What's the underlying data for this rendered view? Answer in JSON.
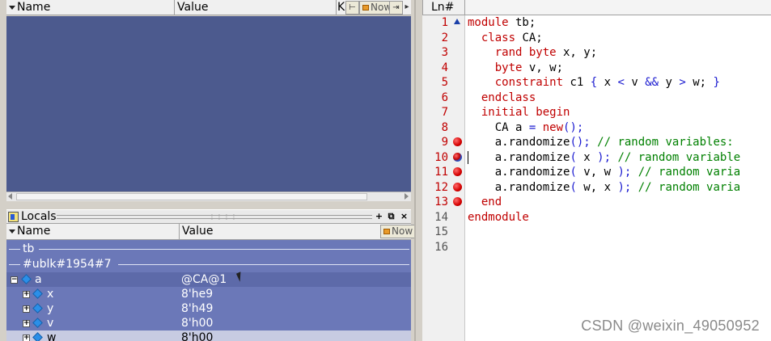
{
  "wave_panel": {
    "columns": [
      {
        "label": "Name"
      },
      {
        "label": "Value"
      },
      {
        "label": "K"
      }
    ],
    "now_label": "Now"
  },
  "locals_panel": {
    "title": "Locals",
    "columns": [
      {
        "label": "Name"
      },
      {
        "label": "Value"
      }
    ],
    "now_label": "Now",
    "groups": [
      "tb",
      "#ublk#1954#7"
    ],
    "rows": [
      {
        "name": "a",
        "value": "@CA@1",
        "expanded": true
      },
      {
        "name": "x",
        "value": "8'he9"
      },
      {
        "name": "y",
        "value": "8'h49"
      },
      {
        "name": "v",
        "value": "8'h00"
      },
      {
        "name": "w",
        "value": "8'h00"
      }
    ]
  },
  "source_panel": {
    "header_label": "Ln#",
    "lines": [
      {
        "num": "1",
        "marker": "arrow",
        "tokens": [
          {
            "t": "module",
            "c": "k"
          },
          {
            "t": " tb;",
            "c": "n"
          }
        ]
      },
      {
        "num": "2",
        "marker": "",
        "tokens": [
          {
            "t": "  class",
            "c": "k"
          },
          {
            "t": " CA;",
            "c": "n"
          }
        ]
      },
      {
        "num": "3",
        "marker": "",
        "tokens": [
          {
            "t": "    rand byte",
            "c": "k"
          },
          {
            "t": " x, y;",
            "c": "n"
          }
        ]
      },
      {
        "num": "4",
        "marker": "",
        "tokens": [
          {
            "t": "    byte",
            "c": "k"
          },
          {
            "t": " v, w;",
            "c": "n"
          }
        ]
      },
      {
        "num": "5",
        "marker": "",
        "tokens": [
          {
            "t": "    constraint",
            "c": "k"
          },
          {
            "t": " c1 ",
            "c": "n"
          },
          {
            "t": "{",
            "c": "b"
          },
          {
            "t": " x ",
            "c": "n"
          },
          {
            "t": "<",
            "c": "b"
          },
          {
            "t": " v ",
            "c": "n"
          },
          {
            "t": "&&",
            "c": "b"
          },
          {
            "t": " y ",
            "c": "n"
          },
          {
            "t": ">",
            "c": "b"
          },
          {
            "t": " w; ",
            "c": "n"
          },
          {
            "t": "}",
            "c": "b"
          }
        ]
      },
      {
        "num": "6",
        "marker": "",
        "tokens": [
          {
            "t": "  endclass",
            "c": "k"
          }
        ]
      },
      {
        "num": "7",
        "marker": "",
        "tokens": [
          {
            "t": "  initial begin",
            "c": "k"
          }
        ]
      },
      {
        "num": "8",
        "marker": "",
        "tokens": [
          {
            "t": "    CA a ",
            "c": "n"
          },
          {
            "t": "=",
            "c": "b"
          },
          {
            "t": " ",
            "c": "n"
          },
          {
            "t": "new",
            "c": "k"
          },
          {
            "t": "();",
            "c": "b"
          }
        ]
      },
      {
        "num": "9",
        "marker": "bp",
        "tokens": [
          {
            "t": "    a.randomize",
            "c": "n"
          },
          {
            "t": "();",
            "c": "b"
          },
          {
            "t": " // random variables: ",
            "c": "c"
          }
        ]
      },
      {
        "num": "10",
        "marker": "bp-blue",
        "tokens": [
          {
            "t": "    a.randomize",
            "c": "n"
          },
          {
            "t": "(",
            "c": "b"
          },
          {
            "t": " x ",
            "c": "n"
          },
          {
            "t": ");",
            "c": "b"
          },
          {
            "t": " // random variable",
            "c": "c"
          }
        ]
      },
      {
        "num": "11",
        "marker": "bp",
        "tokens": [
          {
            "t": "    a.randomize",
            "c": "n"
          },
          {
            "t": "(",
            "c": "b"
          },
          {
            "t": " v, w ",
            "c": "n"
          },
          {
            "t": ");",
            "c": "b"
          },
          {
            "t": " // random varia",
            "c": "c"
          }
        ]
      },
      {
        "num": "12",
        "marker": "bp",
        "tokens": [
          {
            "t": "    a.randomize",
            "c": "n"
          },
          {
            "t": "(",
            "c": "b"
          },
          {
            "t": " w, x ",
            "c": "n"
          },
          {
            "t": ");",
            "c": "b"
          },
          {
            "t": " // random varia",
            "c": "c"
          }
        ]
      },
      {
        "num": "13",
        "marker": "bp",
        "tokens": [
          {
            "t": "  end",
            "c": "k"
          }
        ]
      },
      {
        "num": "14",
        "marker": "",
        "tokens": [
          {
            "t": "endmodule",
            "c": "k"
          }
        ]
      },
      {
        "num": "15",
        "marker": "",
        "tokens": []
      },
      {
        "num": "16",
        "marker": "",
        "tokens": []
      }
    ]
  },
  "watermark": "CSDN @weixin_49050952"
}
